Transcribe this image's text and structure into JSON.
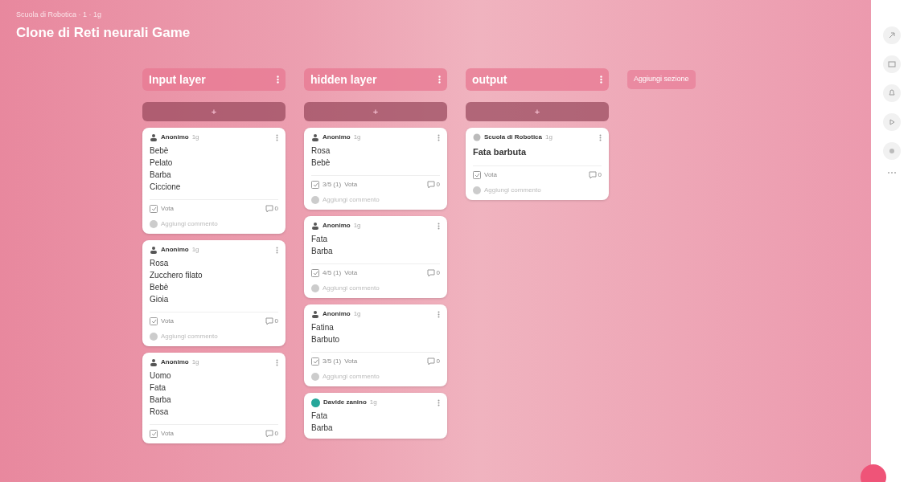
{
  "breadcrumb": "Scuola di Robotica · 1 · 1g",
  "title": "Clone di Reti neurali Game",
  "add_section": "Aggiungi sezione",
  "columns": [
    {
      "title": "Input layer",
      "add": "+",
      "posts": [
        {
          "kind": "anon",
          "author": "Anonimo",
          "time": "1g",
          "lines": [
            "Bebè",
            "Pelato",
            "Barba",
            "Ciccione"
          ],
          "vote": "Vota",
          "comments": "0",
          "add_comment": "Aggiungi commento"
        },
        {
          "kind": "anon",
          "author": "Anonimo",
          "time": "1g",
          "lines": [
            "Rosa",
            "Zucchero filato",
            "Bebè",
            "Gioia"
          ],
          "vote": "Vota",
          "comments": "0",
          "add_comment": "Aggiungi commento"
        },
        {
          "kind": "anon",
          "author": "Anonimo",
          "time": "1g",
          "lines": [
            "Uomo",
            "Fata",
            "Barba",
            "Rosa"
          ],
          "vote": "Vota",
          "comments": "0"
        }
      ]
    },
    {
      "title": "hidden layer",
      "add": "+",
      "posts": [
        {
          "kind": "anon",
          "author": "Anonimo",
          "time": "1g",
          "lines": [
            "Rosa",
            "Bebè"
          ],
          "rating": "3/5 (1)",
          "vote": "Vota",
          "comments": "0",
          "add_comment": "Aggiungi commento"
        },
        {
          "kind": "anon",
          "author": "Anonimo",
          "time": "1g",
          "lines": [
            "Fata",
            "Barba"
          ],
          "rating": "4/5 (1)",
          "vote": "Vota",
          "comments": "0",
          "add_comment": "Aggiungi commento"
        },
        {
          "kind": "anon",
          "author": "Anonimo",
          "time": "1g",
          "lines": [
            "Fatina",
            "Barbuto"
          ],
          "rating": "3/5 (1)",
          "vote": "Vota",
          "comments": "0",
          "add_comment": "Aggiungi commento"
        },
        {
          "kind": "user",
          "author": "Davide zanino",
          "time": "1g",
          "lines": [
            "Fata",
            "Barba"
          ]
        }
      ]
    },
    {
      "title": "output",
      "add": "+",
      "posts": [
        {
          "kind": "school",
          "author": "Scuola di Robotica",
          "time": "1g",
          "title": "Fata barbuta",
          "vote": "Vota",
          "comments": "0",
          "add_comment": "Aggiungi commento"
        }
      ]
    }
  ]
}
